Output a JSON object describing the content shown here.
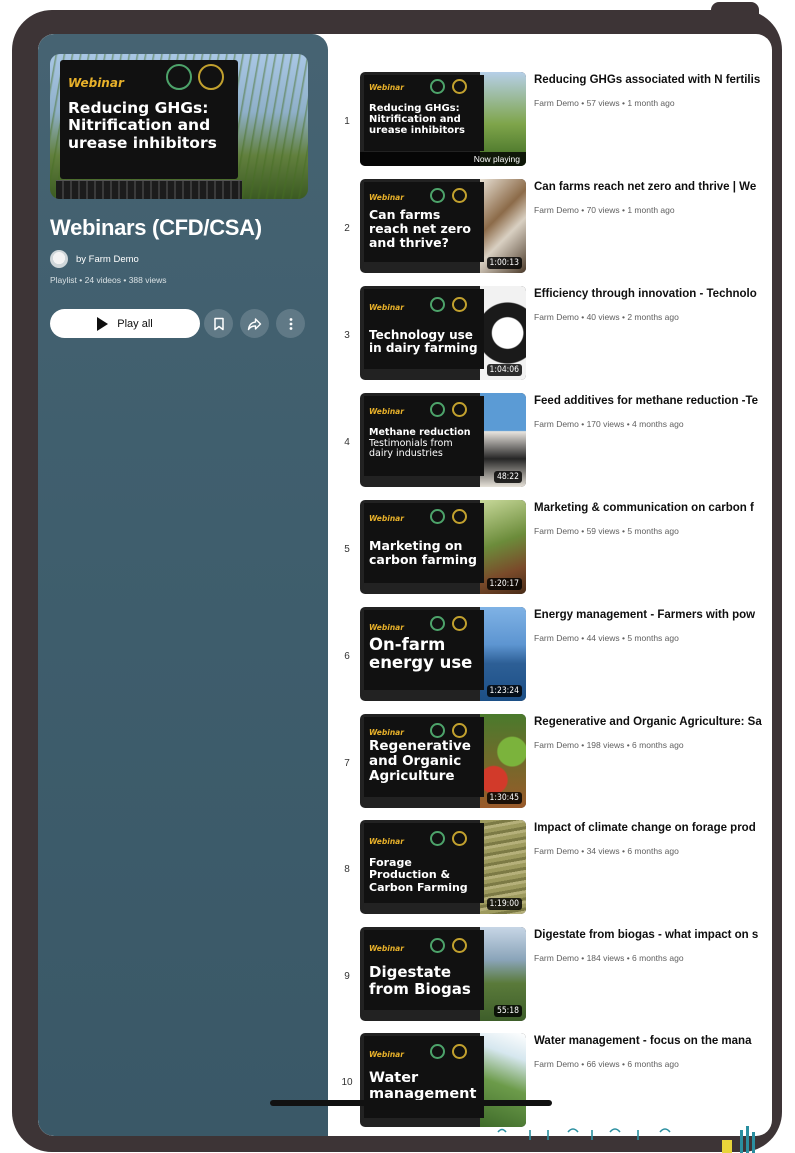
{
  "colors": {
    "sidebar": "#3f5e6d",
    "tablet_frame": "#3d3436",
    "accent_webinar": "#e8b12a"
  },
  "playlist": {
    "hero_tag": "Webinar",
    "hero_title_lines": [
      "Reducing GHGs:",
      "Nitrification and",
      "urease inhibitors"
    ],
    "title": "Webinars (CFD/CSA)",
    "owner": "by Farm Demo",
    "meta": "Playlist • 24 videos • 388 views",
    "play_all": "Play all",
    "icons": [
      "play-icon",
      "bookmark-icon",
      "share-icon",
      "more-vert-icon"
    ]
  },
  "videos": [
    {
      "index": "1",
      "tag": "Webinar",
      "slide_lines": [
        "Reducing GHGs:",
        "Nitrification and",
        "urease inhibitors"
      ],
      "badge": "Now playing",
      "title": "Reducing GHGs associated with N fertilis",
      "meta": "Farm Demo • 57 views • 1 month ago"
    },
    {
      "index": "2",
      "tag": "Webinar",
      "slide_lines": [
        "Can farms",
        "reach net zero",
        "and thrive?"
      ],
      "badge": "1:00:13",
      "title": "Can farms reach net zero and thrive | We",
      "meta": "Farm Demo • 70 views • 1 month ago"
    },
    {
      "index": "3",
      "tag": "Webinar",
      "slide_lines": [
        "Technology use",
        "in dairy farming"
      ],
      "badge": "1:04:06",
      "title": "Efficiency through innovation - Technolo",
      "meta": "Farm Demo • 40 views • 2 months ago"
    },
    {
      "index": "4",
      "tag": "Webinar",
      "slide_lines": [
        "Methane reduction",
        "Testimonials from",
        "dairy industries"
      ],
      "badge": "48:22",
      "title": "Feed additives for methane reduction -Te",
      "meta": "Farm Demo • 170 views • 4 months ago"
    },
    {
      "index": "5",
      "tag": "Webinar",
      "slide_lines": [
        "Marketing on",
        "carbon farming"
      ],
      "badge": "1:20:17",
      "title": "Marketing & communication on carbon f",
      "meta": "Farm Demo • 59 views • 5 months ago"
    },
    {
      "index": "6",
      "tag": "Webinar",
      "slide_lines": [
        "On-farm",
        "energy use"
      ],
      "badge": "1:23:24",
      "title": "Energy management - Farmers with pow",
      "meta": "Farm Demo • 44 views • 5 months ago"
    },
    {
      "index": "7",
      "tag": "Webinar",
      "slide_lines": [
        "Regenerative",
        "and Organic",
        "Agriculture"
      ],
      "badge": "1:30:45",
      "title": "Regenerative and Organic Agriculture: Sa",
      "meta": "Farm Demo • 198 views • 6 months ago"
    },
    {
      "index": "8",
      "tag": "Webinar",
      "slide_lines": [
        "Forage",
        "Production &",
        "Carbon Farming"
      ],
      "badge": "1:19:00",
      "title": "Impact of climate change on forage prod",
      "meta": "Farm Demo • 34 views • 6 months ago"
    },
    {
      "index": "9",
      "tag": "Webinar",
      "slide_lines": [
        "Digestate",
        "from Biogas"
      ],
      "badge": "55:18",
      "title": "Digestate from biogas - what impact on s",
      "meta": "Farm Demo • 184 views • 6 months ago"
    },
    {
      "index": "10",
      "tag": "Webinar",
      "slide_lines": [
        "Water",
        "management"
      ],
      "badge": "",
      "title": "Water management - focus on the mana",
      "meta": "Farm Demo • 66 views • 6 months ago"
    }
  ]
}
